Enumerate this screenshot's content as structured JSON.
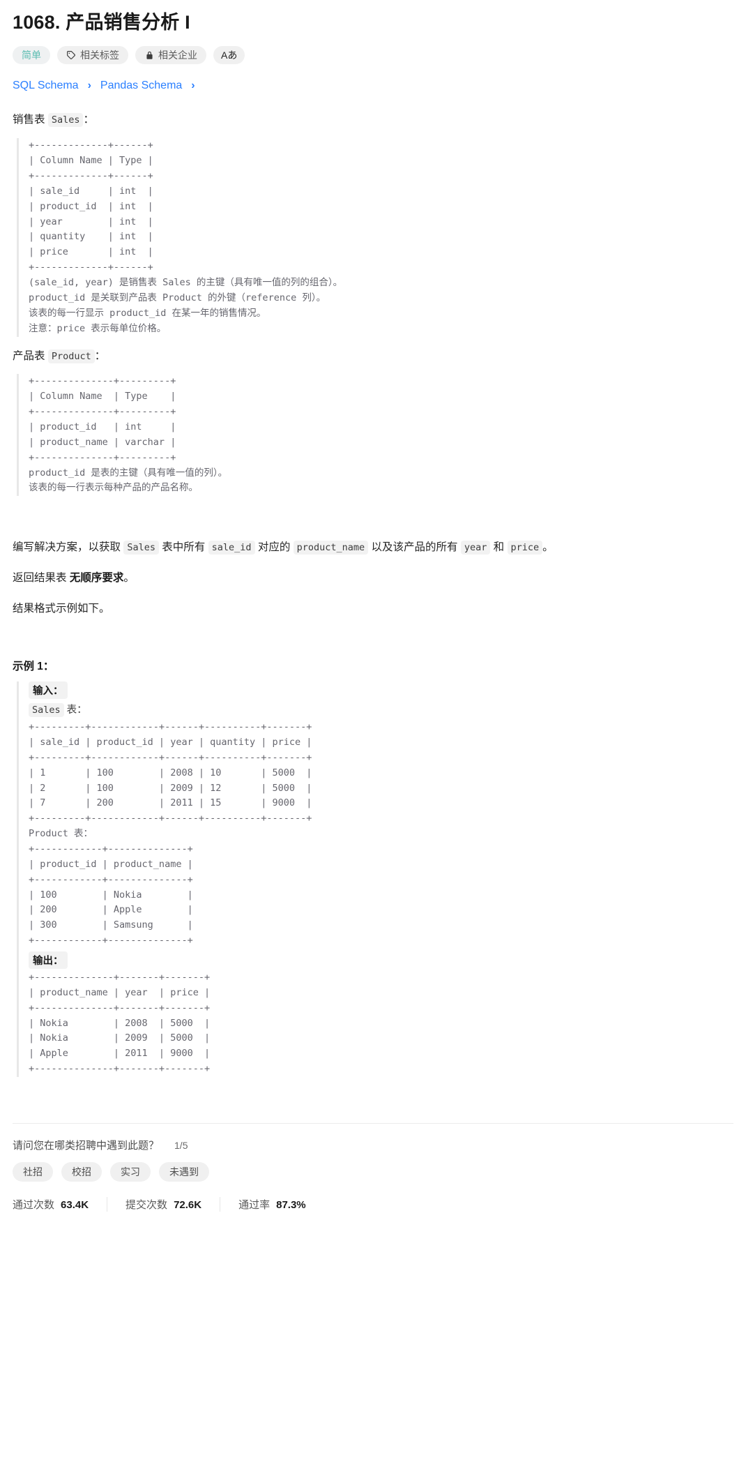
{
  "problem": {
    "title": "1068. 产品销售分析 I",
    "pills": [
      {
        "name": "difficulty-pill",
        "label": "简单",
        "icon": null
      },
      {
        "name": "related-tags-pill",
        "label": "相关标签",
        "icon": "tag-icon"
      },
      {
        "name": "related-companies-pill",
        "label": "相关企业",
        "icon": "lock-icon"
      },
      {
        "name": "font-size-pill",
        "label": "Aあ",
        "icon": null
      }
    ],
    "schema_tabs": [
      {
        "label": "SQL Schema"
      },
      {
        "label": "Pandas Schema"
      }
    ],
    "chevron": "›"
  },
  "sales_section": {
    "heading_prefix": "销售表",
    "heading_code": "Sales",
    "heading_suffix": "：",
    "ascii_table": "+-------------+------+\n| Column Name | Type |\n+-------------+------+\n| sale_id     | int  |\n| product_id  | int  |\n| year        | int  |\n| quantity    | int  |\n| price       | int  |\n+-------------+------+",
    "notes": "(sale_id, year) 是销售表 Sales 的主键（具有唯一值的列的组合）。\nproduct_id 是关联到产品表 Product 的外键（reference 列）。\n该表的每一行显示 product_id 在某一年的销售情况。\n注意：price 表示每单位价格。"
  },
  "product_section": {
    "heading_prefix": "产品表",
    "heading_code": "Product",
    "heading_suffix": "：",
    "ascii_table": "+--------------+---------+\n| Column Name  | Type    |\n+--------------+---------+\n| product_id   | int     |\n| product_name | varchar |\n+--------------+---------+",
    "notes": "product_id 是表的主键（具有唯一值的列）。\n该表的每一行表示每种产品的产品名称。"
  },
  "statement": {
    "line1_a": "编写解决方案，以获取",
    "code_sales": "Sales",
    "line1_b": "表中所有",
    "code_sale_id": "sale_id",
    "line1_c": "对应的",
    "code_product_name": "product_name",
    "line1_d": "以及该产品的所有",
    "code_year": "year",
    "line1_e": "和",
    "code_price": "price",
    "line1_f": "。",
    "line2_a": "返回结果表",
    "line2_bold": "无顺序要求",
    "line2_b": "。",
    "line3": "结果格式示例如下。"
  },
  "example": {
    "heading": "示例 1：",
    "input_label": "输入：",
    "sales_table_name": "Sales",
    "sales_table_suffix": "表：",
    "sales_ascii": "+---------+------------+------+----------+-------+\n| sale_id | product_id | year | quantity | price |\n+---------+------------+------+----------+-------+\n| 1       | 100        | 2008 | 10       | 5000  |\n| 2       | 100        | 2009 | 12       | 5000  |\n| 7       | 200        | 2011 | 15       | 9000  |\n+---------+------------+------+----------+-------+",
    "product_table_line": "Product 表：",
    "product_ascii": "+------------+--------------+\n| product_id | product_name |\n+------------+--------------+\n| 100        | Nokia        |\n| 200        | Apple        |\n| 300        | Samsung      |\n+------------+--------------+",
    "output_label": "输出：",
    "output_ascii": "+--------------+-------+-------+\n| product_name | year  | price |\n+--------------+-------+-------+\n| Nokia        | 2008  | 5000  |\n| Nokia        | 2009  | 5000  |\n| Apple        | 2011  | 9000  |\n+--------------+-------+-------+"
  },
  "footer": {
    "poll_question": "请问您在哪类招聘中遇到此题？",
    "poll_progress": "1/5",
    "poll_options": [
      "社招",
      "校招",
      "实习",
      "未遇到"
    ],
    "stats": [
      {
        "label": "通过次数",
        "value": "63.4K"
      },
      {
        "label": "提交次数",
        "value": "72.6K"
      },
      {
        "label": "通过率",
        "value": "87.3%"
      }
    ]
  }
}
